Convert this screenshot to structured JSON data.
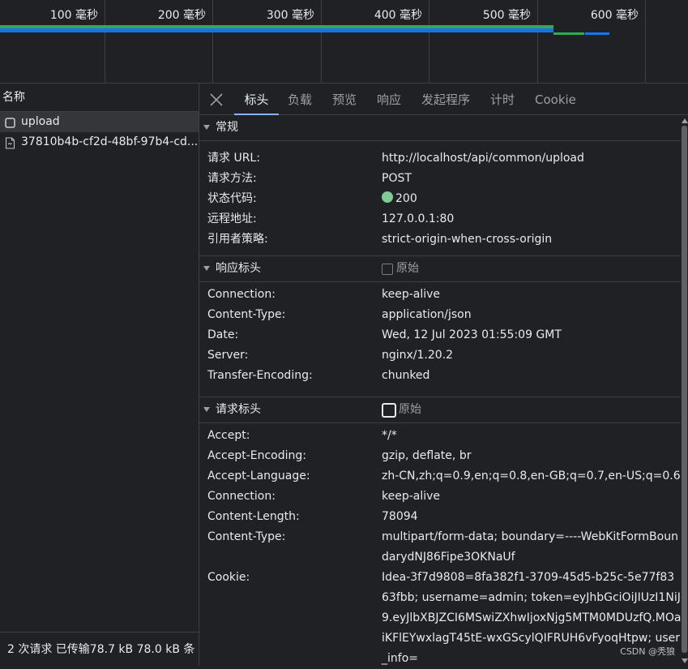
{
  "timeline": {
    "ticks": [
      "100 毫秒",
      "200 毫秒",
      "300 毫秒",
      "400 毫秒",
      "500 毫秒",
      "600 毫秒"
    ],
    "colors": {
      "waiting": "#34a853",
      "download": "#1a73e8"
    }
  },
  "request_list": {
    "header": "名称",
    "items": [
      {
        "name": "upload",
        "icon": "checkbox-icon",
        "selected": true
      },
      {
        "name": "37810b4b-cf2d-48bf-97b4-cd...",
        "icon": "file-icon",
        "selected": false
      }
    ],
    "status": "2 次请求  已传输78.7 kB  78.0 kB 条"
  },
  "tabs": [
    "标头",
    "负载",
    "预览",
    "响应",
    "发起程序",
    "计时",
    "Cookie"
  ],
  "active_tab": "标头",
  "general": {
    "title": "常规",
    "rows": [
      {
        "key": "请求 URL:",
        "value": "http://localhost/api/common/upload"
      },
      {
        "key": "请求方法:",
        "value": "POST"
      },
      {
        "key": "状态代码:",
        "value": "200",
        "status_color": "#81c995"
      },
      {
        "key": "远程地址:",
        "value": "127.0.0.1:80"
      },
      {
        "key": "引用者策略:",
        "value": "strict-origin-when-cross-origin"
      }
    ]
  },
  "response_headers": {
    "title": "响应标头",
    "raw_label": "原始",
    "rows": [
      {
        "key": "Connection:",
        "value": "keep-alive"
      },
      {
        "key": "Content-Type:",
        "value": "application/json"
      },
      {
        "key": "Date:",
        "value": "Wed, 12 Jul 2023 01:55:09 GMT"
      },
      {
        "key": "Server:",
        "value": "nginx/1.20.2"
      },
      {
        "key": "Transfer-Encoding:",
        "value": "chunked"
      }
    ]
  },
  "request_headers": {
    "title": "请求标头",
    "raw_label": "原始",
    "rows": [
      {
        "key": "Accept:",
        "value": "*/*"
      },
      {
        "key": "Accept-Encoding:",
        "value": "gzip, deflate, br"
      },
      {
        "key": "Accept-Language:",
        "value": "zh-CN,zh;q=0.9,en;q=0.8,en-GB;q=0.7,en-US;q=0.6"
      },
      {
        "key": "Connection:",
        "value": "keep-alive"
      },
      {
        "key": "Content-Length:",
        "value": "78094"
      },
      {
        "key": "Content-Type:",
        "value": "multipart/form-data; boundary=----WebKitFormBoundarydNJ86Fipe3OKNaUf"
      },
      {
        "key": "Cookie:",
        "value": "Idea-3f7d9808=8fa382f1-3709-45d5-b25c-5e77f8363fbb; username=admin; token=eyJhbGciOiJIUzI1NiJ9.eyJlbXBJZCI6MSwiZXhwIjoxNjg5MTM0MDUzfQ.MOaiKFlEYwxlagT45tE-wxGScylQIFRUH6vFyoqHtpw; user_info="
      }
    ]
  },
  "watermark": "CSDN @秃狼"
}
